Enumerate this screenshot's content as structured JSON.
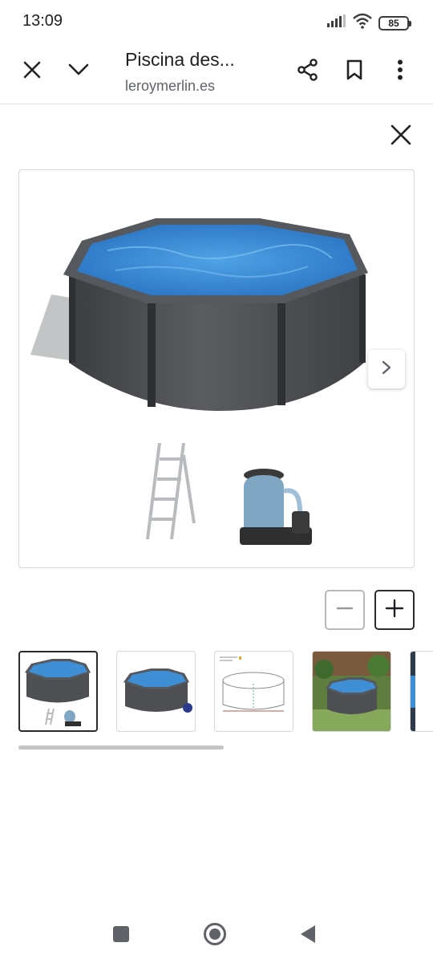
{
  "status_bar": {
    "time": "13:09",
    "battery": "85",
    "icons": [
      "signal-icon",
      "wifi-icon",
      "battery-icon"
    ]
  },
  "toolbar": {
    "title": "Piscina des...",
    "url": "leroymerlin.es",
    "icons": [
      "close-icon",
      "chevron-down-icon",
      "share-icon",
      "bookmark-icon",
      "more-vert-icon"
    ]
  },
  "lightbox": {
    "close_icon": "close-icon",
    "next_icon": "chevron-right-icon",
    "zoom_out_icon": "minus-icon",
    "zoom_in_icon": "plus-icon",
    "thumbnails": [
      {
        "content": "pool-with-ladder-and-filter",
        "selected": true
      },
      {
        "content": "pool-with-badge",
        "selected": false
      },
      {
        "content": "pool-dimensions-diagram",
        "selected": false
      },
      {
        "content": "pool-in-garden-photo",
        "selected": false
      },
      {
        "content": "partial-thumbnail",
        "selected": false
      }
    ]
  },
  "colors": {
    "pool_water": "#3f8fd6",
    "pool_wall": "#4d4f52",
    "accent_border": "#2b2b2b"
  },
  "nav_bar": {
    "icons": [
      "recents-square-icon",
      "home-circle-icon",
      "back-triangle-icon"
    ]
  }
}
